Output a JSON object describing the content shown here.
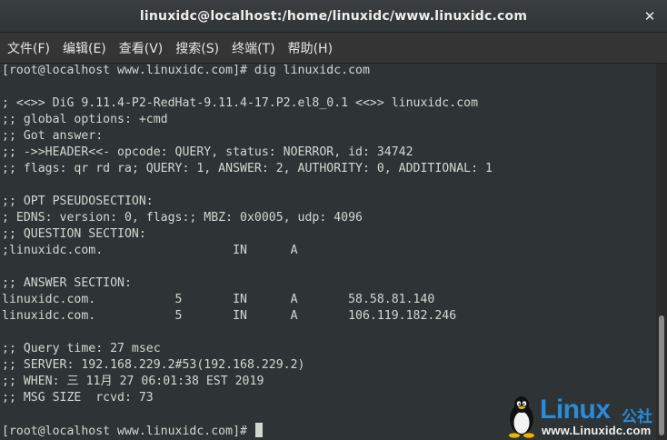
{
  "window": {
    "title": "linuxidc@localhost:/home/linuxidc/www.linuxidc.com",
    "close_icon": "close-icon"
  },
  "menubar": {
    "items": [
      {
        "label": "文件(F)"
      },
      {
        "label": "编辑(E)"
      },
      {
        "label": "查看(V)"
      },
      {
        "label": "搜索(S)"
      },
      {
        "label": "终端(T)"
      },
      {
        "label": "帮助(H)"
      }
    ]
  },
  "terminal": {
    "lines": [
      "[root@localhost www.linuxidc.com]# dig linuxidc.com",
      "",
      "; <<>> DiG 9.11.4-P2-RedHat-9.11.4-17.P2.el8_0.1 <<>> linuxidc.com",
      ";; global options: +cmd",
      ";; Got answer:",
      ";; ->>HEADER<<- opcode: QUERY, status: NOERROR, id: 34742",
      ";; flags: qr rd ra; QUERY: 1, ANSWER: 2, AUTHORITY: 0, ADDITIONAL: 1",
      "",
      ";; OPT PSEUDOSECTION:",
      "; EDNS: version: 0, flags:; MBZ: 0x0005, udp: 4096",
      ";; QUESTION SECTION:",
      ";linuxidc.com.                  IN      A",
      "",
      ";; ANSWER SECTION:",
      "linuxidc.com.           5       IN      A       58.58.81.140",
      "linuxidc.com.           5       IN      A       106.119.182.246",
      "",
      ";; Query time: 27 msec",
      ";; SERVER: 192.168.229.2#53(192.168.229.2)",
      ";; WHEN: 三 11月 27 06:01:38 EST 2019",
      ";; MSG SIZE  rcvd: 73",
      "",
      "[root@localhost www.linuxidc.com]# "
    ]
  },
  "watermark": {
    "brand": "Linux",
    "brand_cn": "公社",
    "url": "www.Linuxidc.com",
    "logo_icon": "tux-penguin-icon"
  },
  "colors": {
    "terminal_bg": "#2e3436",
    "terminal_fg": "#d3d7cf",
    "brand_blue": "#2a8bd8"
  }
}
